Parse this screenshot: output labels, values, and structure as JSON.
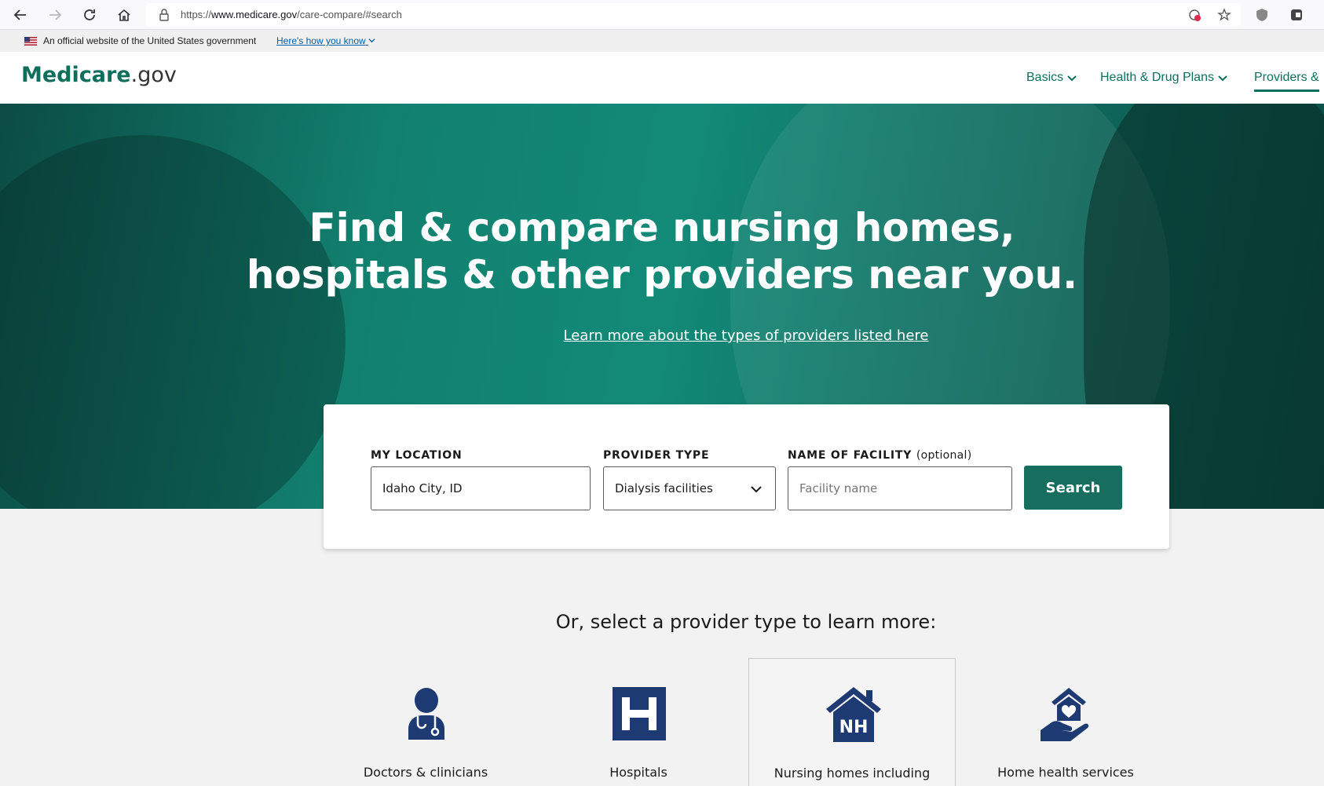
{
  "browser": {
    "url_scheme": "https://",
    "url_host": "www.medicare.gov",
    "url_path": "/care-compare/#search"
  },
  "gov_banner": {
    "text": "An official website of the United States government",
    "link": "Here's how you know"
  },
  "header": {
    "logo_brand": "Medicare",
    "logo_tld": ".gov",
    "nav": [
      "Basics",
      "Health & Drug Plans",
      "Providers &"
    ]
  },
  "hero": {
    "title_line1": "Find & compare nursing homes,",
    "title_line2": "hospitals & other providers near you.",
    "link": "Learn more about the types of providers listed here"
  },
  "search": {
    "location_label": "MY LOCATION",
    "location_value": "Idaho City, ID",
    "provider_label": "PROVIDER TYPE",
    "provider_value": "Dialysis facilities",
    "facility_label": "NAME OF FACILITY",
    "facility_label_optional": "(optional)",
    "facility_placeholder": "Facility name",
    "button": "Search"
  },
  "provider_section": {
    "title": "Or, select a provider type to learn more:",
    "tiles": [
      {
        "label": "Doctors & clinicians",
        "icon": "doctor-icon"
      },
      {
        "label": "Hospitals",
        "icon": "hospital-icon"
      },
      {
        "label": "Nursing homes including",
        "icon": "nursing-home-icon"
      },
      {
        "label": "Home health services",
        "icon": "home-health-icon"
      }
    ]
  },
  "colors": {
    "brand_green": "#0f6f5c",
    "button_green": "#176e5e",
    "icon_navy": "#1e3a73"
  }
}
